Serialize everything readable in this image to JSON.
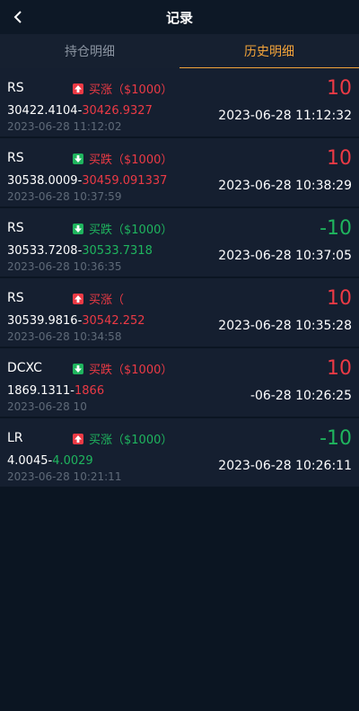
{
  "header": {
    "title": "记录"
  },
  "tabs": [
    {
      "label": "持仓明细",
      "active": false
    },
    {
      "label": "历史明细",
      "active": true
    }
  ],
  "colors": {
    "up": "#ec3a45",
    "down": "#1fb55e",
    "accent": "#f3a43a"
  },
  "records": [
    {
      "symbol": "RS",
      "direction": "up",
      "label": "买涨（$1000）",
      "label_color": "red",
      "open_price": "30422.4104-",
      "close_price": "30426.9327",
      "close_color": "red",
      "open_time": "2023-06-28 11:12:02",
      "amount": "10",
      "amount_color": "red",
      "close_time": "2023-06-28 11:12:32"
    },
    {
      "symbol": "RS",
      "direction": "down",
      "label": "买跌（$1000）",
      "label_color": "red",
      "open_price": "30538.0009-",
      "close_price": "30459.091337",
      "close_color": "red",
      "open_time": "2023-06-28 10:37:59",
      "amount": "10",
      "amount_color": "red",
      "close_time": "2023-06-28 10:38:29"
    },
    {
      "symbol": "RS",
      "direction": "down",
      "label": "买跌（$1000）",
      "label_color": "green",
      "open_price": "30533.7208-",
      "close_price": "30533.7318",
      "close_color": "green",
      "open_time": "2023-06-28 10:36:35",
      "amount": "-10",
      "amount_color": "green",
      "close_time": "2023-06-28 10:37:05"
    },
    {
      "symbol": "RS",
      "direction": "up",
      "label": "买涨（",
      "label_color": "red",
      "open_price": "30539.9816-",
      "close_price": "30542.252",
      "close_color": "red",
      "open_time": "2023-06-28 10:34:58",
      "amount": "10",
      "amount_color": "red",
      "close_time": "2023-06-28 10:35:28"
    },
    {
      "symbol": "DCXC",
      "direction": "down",
      "label": "买跌（$1000）",
      "label_color": "red",
      "open_price": "1869.1311-",
      "close_price": "1866",
      "close_color": "red",
      "open_time": "2023-06-28 10",
      "amount": "10",
      "amount_color": "red",
      "close_time": "-06-28 10:26:25"
    },
    {
      "symbol": "LR",
      "direction": "up",
      "label": "买涨（$1000）",
      "label_color": "green",
      "open_price": "4.0045-",
      "close_price": "4.0029",
      "close_color": "green",
      "open_time": "2023-06-28 10:21:11",
      "amount": "-10",
      "amount_color": "green",
      "close_time": "2023-06-28 10:26:11"
    }
  ]
}
